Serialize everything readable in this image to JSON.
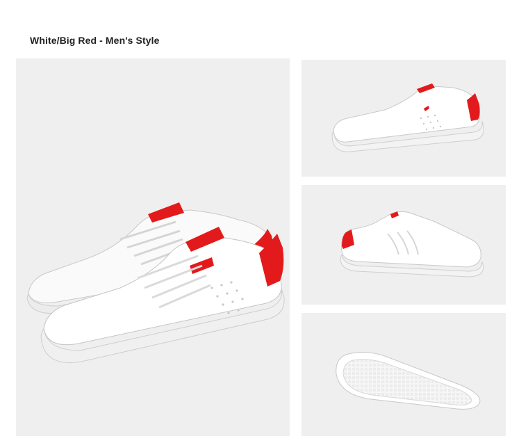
{
  "header": {
    "title": "White/Big Red - Men's Style"
  },
  "gallery": {
    "main": {
      "icon": "sneaker-pair-image"
    },
    "thumbs": [
      {
        "icon": "sneaker-side-view-image"
      },
      {
        "icon": "sneaker-inner-side-image"
      },
      {
        "icon": "sneaker-sole-image"
      }
    ]
  },
  "colors": {
    "upper": "#ffffff",
    "accent": "#e31a1c",
    "background": "#efefef",
    "sole": "#f4f4f4"
  }
}
